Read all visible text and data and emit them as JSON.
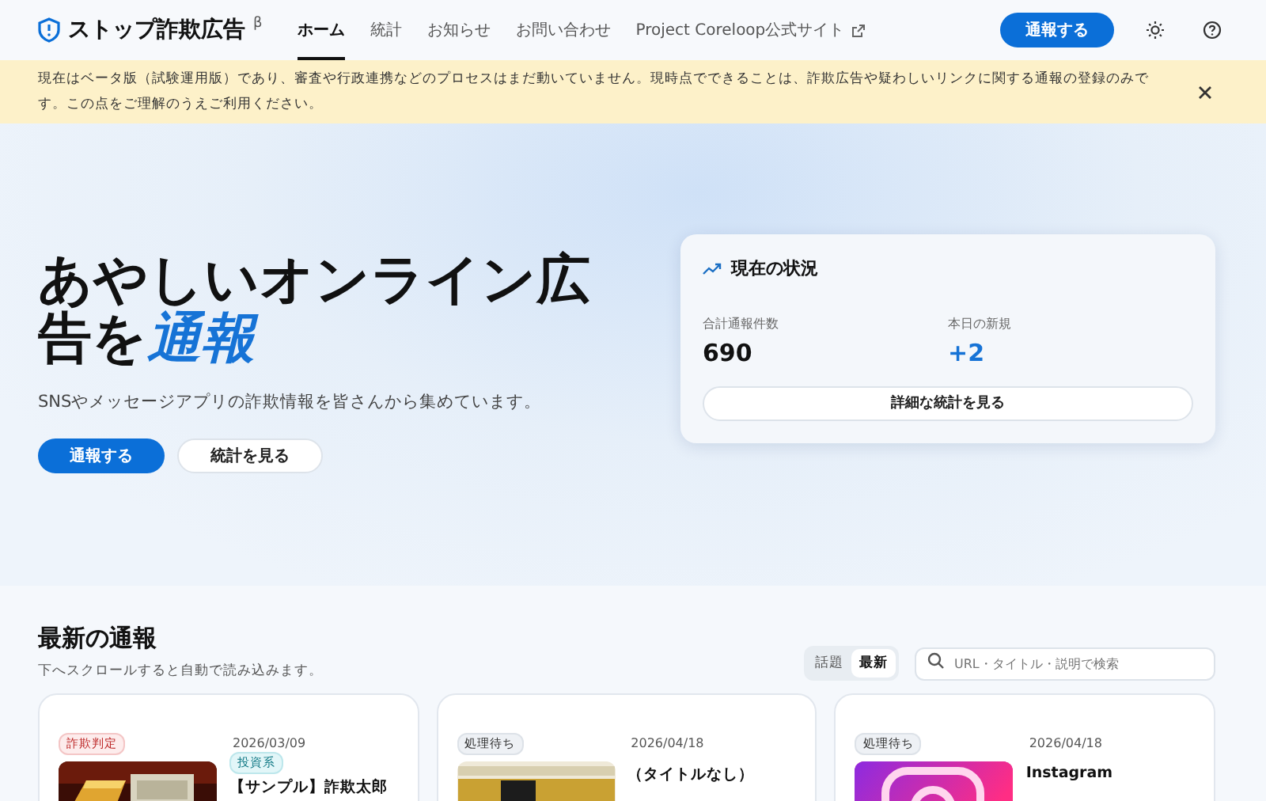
{
  "header": {
    "logo": "ストップ詐欺広告",
    "beta": "β",
    "nav": [
      {
        "label": "ホーム",
        "selected": true,
        "external": false
      },
      {
        "label": "統計",
        "selected": false,
        "external": false
      },
      {
        "label": "お知らせ",
        "selected": false,
        "external": false
      },
      {
        "label": "お問い合わせ",
        "selected": false,
        "external": false
      },
      {
        "label": "Project Coreloop公式サイト",
        "selected": false,
        "external": true
      }
    ],
    "report_button": "通報する"
  },
  "notice": {
    "text": "現在はベータ版（試験運用版）であり、審査や行政連携などのプロセスはまだ動いていません。現時点でできることは、詐欺広告や疑わしいリンクに関する通報の登録のみです。この点をご理解のうえご利用ください。"
  },
  "hero": {
    "title_lead": "あやしいオンライン広告を",
    "title_emphasis": "通報",
    "subtitle": "SNSやメッセージアプリの詐欺情報を皆さんから集めています。",
    "primary_button": "通報する",
    "secondary_button": "統計を見る",
    "status": {
      "title": "現在の状況",
      "stats": [
        {
          "label": "合計通報件数",
          "value": "690",
          "highlight": false
        },
        {
          "label": "本日の新規",
          "value": "+2",
          "highlight": true
        }
      ],
      "button": "詳細な統計を見る"
    }
  },
  "latest": {
    "title": "最新の通報",
    "subtitle": "下へスクロールすると自動で読み込みます。",
    "sort": [
      {
        "label": "話題",
        "selected": false
      },
      {
        "label": "最新",
        "selected": true
      }
    ],
    "search": {
      "placeholder": "URL・タイトル・説明で検索"
    },
    "cards": [
      {
        "status": {
          "label": "詐欺判定",
          "kind": "fraud"
        },
        "date": "2026/03/09",
        "category": "投資系",
        "title": "【サンプル】詐欺太郎"
      },
      {
        "status": {
          "label": "処理待ち",
          "kind": "pending"
        },
        "date": "2026/04/18",
        "title": "（タイトルなし）"
      },
      {
        "status": {
          "label": "処理待ち",
          "kind": "pending"
        },
        "date": "2026/04/18",
        "title": "Instagram"
      }
    ]
  }
}
